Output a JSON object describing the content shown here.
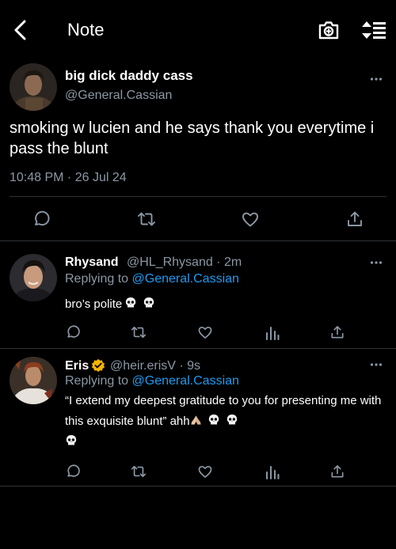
{
  "header": {
    "title": "Note"
  },
  "main_tweet": {
    "display_name": "big dick daddy cass",
    "handle": "@General.Cassian",
    "text": "smoking w lucien and he says thank you everytime i pass the blunt",
    "timestamp": "10:48 PM · 26 Jul 24"
  },
  "replies": [
    {
      "display_name": "Rhysand",
      "meta": "@HL_Rhysand · 2m",
      "replying_prefix": "Replying to ",
      "replying_to": "@General.Cassian",
      "text": "bro’s polite",
      "emoji": [
        "skull",
        "skull"
      ]
    },
    {
      "display_name": "Eris",
      "meta": "@heir.erisV · 9s",
      "replying_prefix": "Replying to ",
      "replying_to": "@General.Cassian",
      "text": "“I extend my deepest gratitude to you for presenting me with this exquisite blunt” ahh",
      "emoji": [
        "folded-hands",
        "skull",
        "skull",
        "skull"
      ],
      "verified": true
    }
  ],
  "colors": {
    "background": "#000000",
    "text": "#e7e9ea",
    "muted": "#8b98a5",
    "link": "#1d9bf0",
    "badge": "#f4b400",
    "divider": "#2f3336"
  }
}
